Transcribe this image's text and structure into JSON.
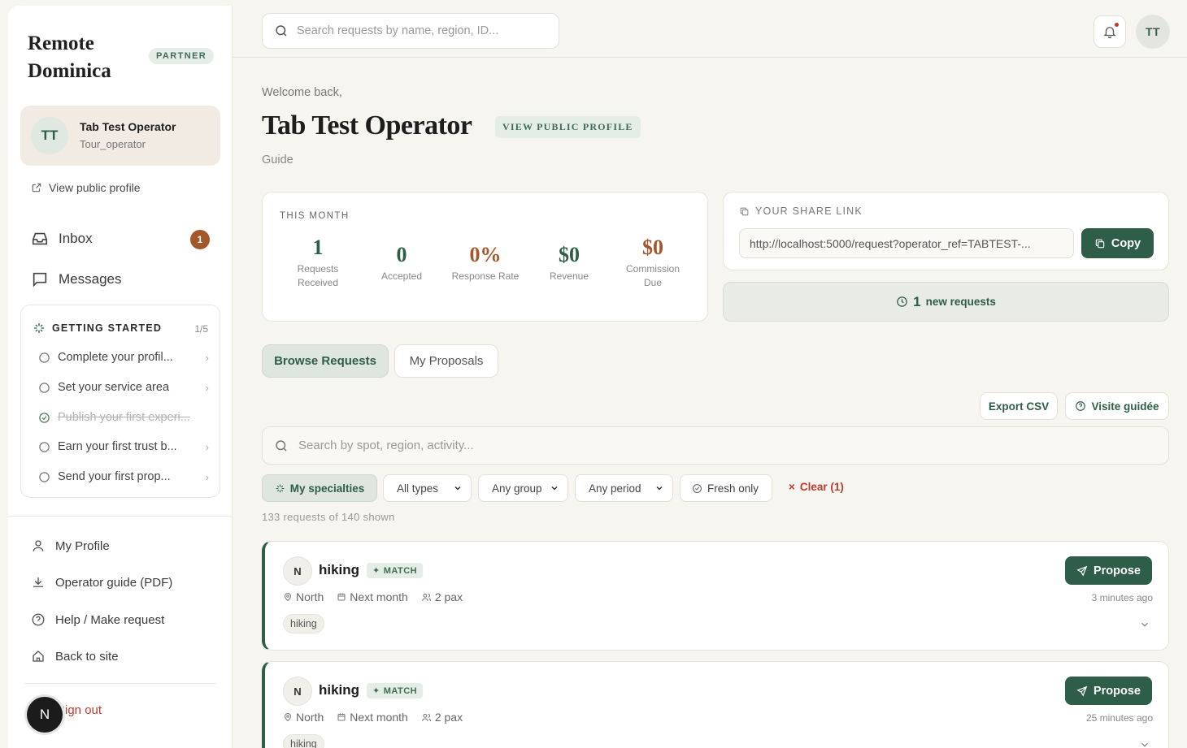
{
  "sidebar": {
    "brand": "Remote Dominica",
    "partner_badge": "PARTNER",
    "profile": {
      "initials": "TT",
      "name": "Tab Test Operator",
      "role": "Tour_operator"
    },
    "view_public_profile": "View public profile",
    "nav": [
      {
        "label": "Inbox",
        "icon": "inbox-icon",
        "badge": "1"
      },
      {
        "label": "Messages",
        "icon": "chat-icon"
      }
    ],
    "getting_started": {
      "title": "GETTING STARTED",
      "progress": "1/5",
      "items": [
        {
          "label": "Complete your profil...",
          "done": false
        },
        {
          "label": "Set your service area",
          "done": false
        },
        {
          "label": "Publish your first experi...",
          "done": true
        },
        {
          "label": "Earn your first trust b...",
          "done": false
        },
        {
          "label": "Send your first prop...",
          "done": false
        }
      ]
    },
    "bottom_links": [
      {
        "label": "My Profile",
        "icon": "user-icon"
      },
      {
        "label": "Operator guide (PDF)",
        "icon": "download-icon"
      },
      {
        "label": "Help / Make request",
        "icon": "help-icon"
      },
      {
        "label": "Back to site",
        "icon": "home-icon"
      }
    ],
    "sign_out": "Sign out",
    "floating_badge": "N"
  },
  "topbar": {
    "search_placeholder": "Search requests by name, region, ID...",
    "avatar_initials": "TT"
  },
  "header": {
    "welcome": "Welcome back,",
    "title": "Tab Test Operator",
    "view_public_profile": "VIEW PUBLIC PROFILE",
    "role": "Guide"
  },
  "stats": {
    "label": "THIS MONTH",
    "items": [
      {
        "value": "1",
        "label": "Requests Received",
        "color": "#2e5e47"
      },
      {
        "value": "0",
        "label": "Accepted",
        "color": "#2e5e47"
      },
      {
        "value": "0%",
        "label": "Response Rate",
        "color": "#a4572a"
      },
      {
        "value": "$0",
        "label": "Revenue",
        "color": "#2e5e47"
      },
      {
        "value": "$0",
        "label": "Commission Due",
        "color": "#a4572a"
      }
    ]
  },
  "share": {
    "label": "YOUR SHARE LINK",
    "url": "http://localhost:5000/request?operator_ref=TABTEST-...",
    "copy_label": "Copy"
  },
  "new_requests": {
    "count": "1",
    "label": "new requests"
  },
  "tabs": {
    "browse": "Browse Requests",
    "proposals": "My Proposals"
  },
  "actions": {
    "export": "Export CSV",
    "tour": "Visite guidée"
  },
  "search": {
    "placeholder": "Search by spot, region, activity..."
  },
  "filters": {
    "specialties": "My specialties",
    "types": "All types",
    "group": "Any group",
    "period": "Any period",
    "fresh": "Fresh only",
    "clear": "Clear (1)"
  },
  "result_count": "133 requests of 140 shown",
  "requests": [
    {
      "initial": "N",
      "title": "hiking",
      "match": "MATCH",
      "region": "North",
      "when": "Next month",
      "pax": "2 pax",
      "tag": "hiking",
      "propose": "Propose",
      "ago": "3 minutes ago"
    },
    {
      "initial": "N",
      "title": "hiking",
      "match": "MATCH",
      "region": "North",
      "when": "Next month",
      "pax": "2 pax",
      "tag": "hiking",
      "propose": "Propose",
      "ago": "25 minutes ago"
    }
  ],
  "colors": {
    "accent": "#2e5e47",
    "brown": "#a4572a",
    "danger": "#c0392b"
  }
}
